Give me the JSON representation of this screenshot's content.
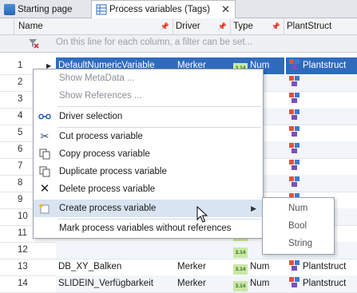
{
  "tabs": [
    {
      "label": "Starting page",
      "icon": "home-icon"
    },
    {
      "label": "Process variables (Tags)",
      "icon": "table-icon",
      "close": "✕"
    }
  ],
  "columns": {
    "name": "Name",
    "driver": "Driver",
    "type": "Type",
    "plantstruct": "PlantStruct"
  },
  "filter_hint": "On this line for each column, a filter can be set...",
  "rows": [
    {
      "num": "1",
      "name": "DefaultNumericVariable",
      "driver": "Merker",
      "type": "Num",
      "ps": "Plantstruct"
    },
    {
      "num": "2"
    },
    {
      "num": "3"
    },
    {
      "num": "4"
    },
    {
      "num": "5"
    },
    {
      "num": "6"
    },
    {
      "num": "7"
    },
    {
      "num": "8"
    },
    {
      "num": "9"
    },
    {
      "num": "10"
    },
    {
      "num": "11"
    },
    {
      "num": "12"
    },
    {
      "num": "13",
      "name": "DB_XY_Balken",
      "driver": "Merker",
      "type": "Num",
      "ps": "Plantstruct"
    },
    {
      "num": "14",
      "name": "SLIDEIN_Verfügbarkeit",
      "driver": "Merker",
      "type": "Num",
      "ps": "Plantstruct"
    }
  ],
  "context_menu": {
    "items": [
      {
        "label": "Show MetaData ...",
        "disabled": true
      },
      {
        "label": "Show References ...",
        "disabled": true
      },
      {
        "label": "Driver selection",
        "icon": "link-icon"
      },
      {
        "label": "Cut process variable",
        "icon": "scissors-icon"
      },
      {
        "label": "Copy process variable",
        "icon": "copy-icon"
      },
      {
        "label": "Duplicate process variable",
        "icon": "duplicate-icon"
      },
      {
        "label": "Delete process variable",
        "icon": "delete-icon"
      },
      {
        "label": "Create process variable",
        "icon": "new-icon",
        "submenu": true
      },
      {
        "label": "Mark process variables without references"
      }
    ],
    "submenu": [
      "Num",
      "Bool",
      "String"
    ]
  },
  "colors": {
    "selection": "#2f6bbd",
    "menu_hot": "#d9e4f2",
    "header_bg": "#f3f4f6"
  }
}
